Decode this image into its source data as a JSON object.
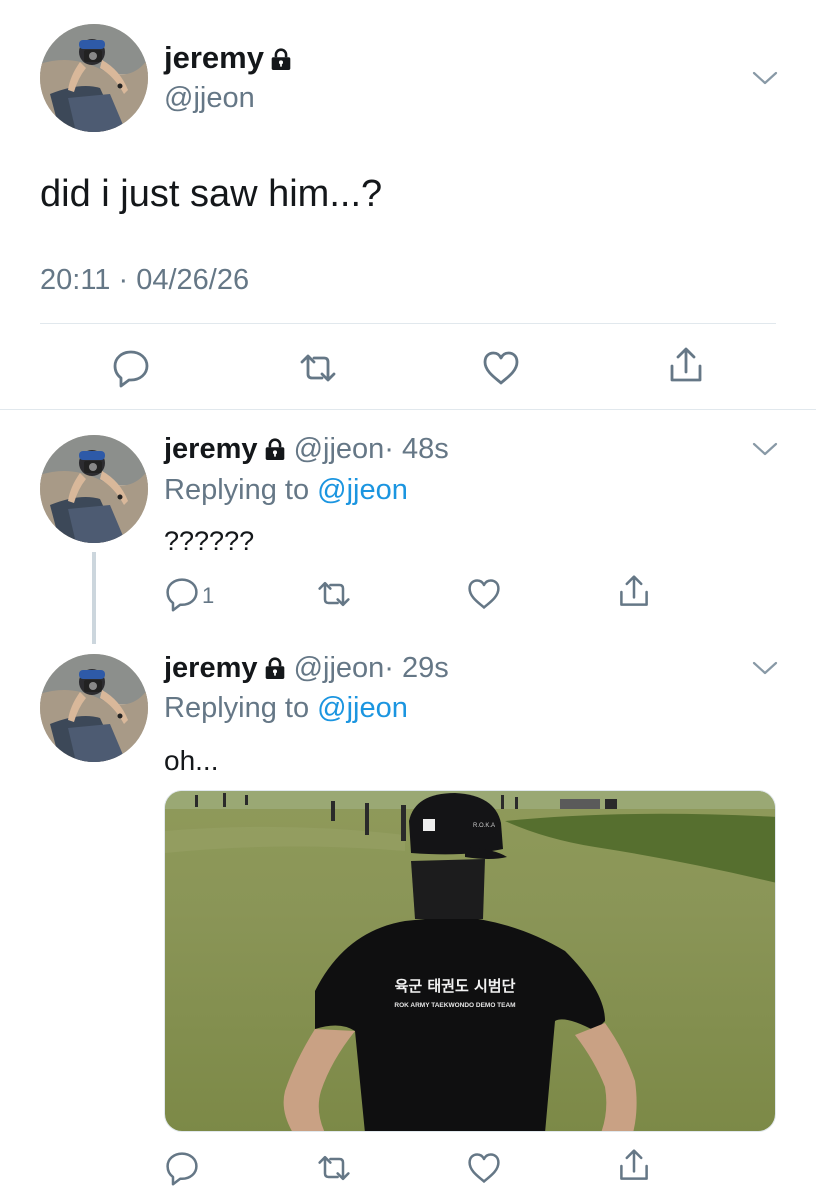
{
  "main_tweet": {
    "display_name": "jeremy",
    "handle": "@jjeon",
    "text": "did i just saw him...?",
    "timestamp": "20:11 · 04/26/26"
  },
  "replies": [
    {
      "display_name": "jeremy",
      "handle": "@jjeon",
      "age": "· 48s",
      "replying_label": "Replying to",
      "replying_to": "@jjeon",
      "text": "??????",
      "reply_count": "1"
    },
    {
      "display_name": "jeremy",
      "handle": "@jjeon",
      "age": "· 29s",
      "replying_label": "Replying to",
      "replying_to": "@jjeon",
      "text": "oh...",
      "image": {
        "shirt_korean": "육군 태권도 시범단",
        "shirt_english": "ROK ARMY TAEKWONDO DEMO TEAM",
        "cap_text": "R.O.K.A"
      }
    }
  ],
  "colors": {
    "text": "#14171a",
    "secondary": "#657786",
    "link": "#1b95e0",
    "border": "#e1e8ed"
  },
  "icons": [
    "lock-icon",
    "chevron-down-icon",
    "reply-icon",
    "retweet-icon",
    "like-icon",
    "share-icon"
  ]
}
